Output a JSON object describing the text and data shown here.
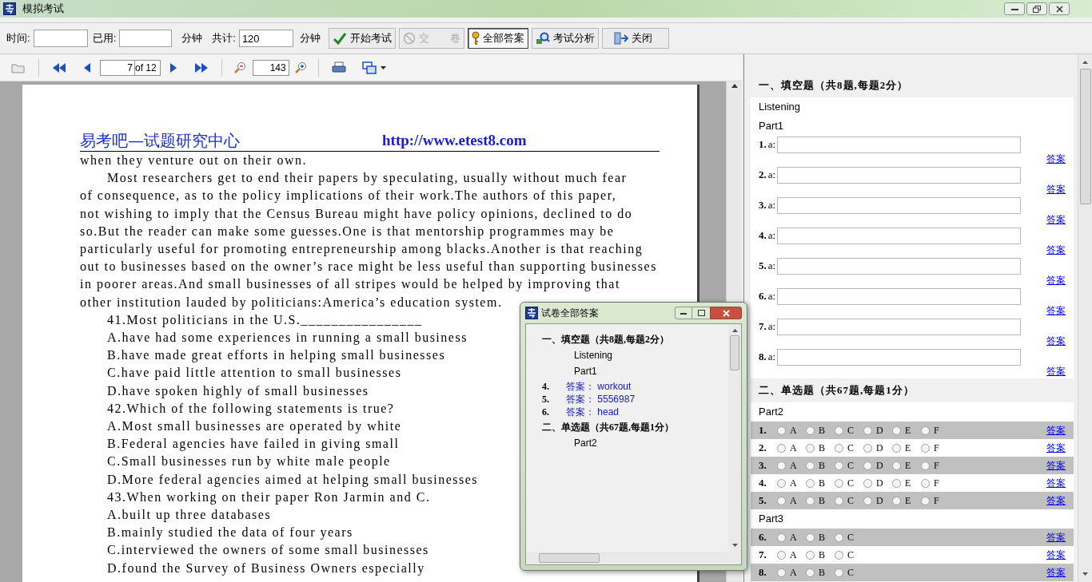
{
  "window": {
    "title": "模拟考试"
  },
  "exam_toolbar": {
    "fields": [
      {
        "label": "时间:"
      },
      {
        "label": "已用:",
        "unit": "分钟"
      },
      {
        "label": "共计:",
        "value": "120",
        "unit": "分钟"
      }
    ],
    "buttons": [
      {
        "kind": "check",
        "label": "开始考试",
        "disabled": false,
        "pressed": false
      },
      {
        "kind": "ban",
        "label": "交　　卷",
        "disabled": true,
        "pressed": false
      },
      {
        "kind": "key",
        "label": "全部答案",
        "disabled": false,
        "pressed": true
      },
      {
        "kind": "analyze",
        "label": "考试分析",
        "disabled": false,
        "pressed": false
      },
      {
        "kind": "exit",
        "label": "关闭",
        "disabled": false,
        "pressed": false
      }
    ]
  },
  "viewer_toolbar": {
    "page": "7",
    "page_total": "of 12",
    "zoom": "143"
  },
  "document": {
    "header_left": "易考吧—试题研究中心",
    "header_right": "http://www.etest8.com",
    "lines": [
      {
        "kind": "plain",
        "text": "when they venture out on their own."
      },
      {
        "kind": "indented",
        "text": "Most researchers get to end their papers by speculating, usually without much fear"
      },
      {
        "kind": "plain",
        "text": "of consequence, as to the policy implications of their work.The authors of this paper,"
      },
      {
        "kind": "plain",
        "text": "not wishing to imply that the Census Bureau might have policy opinions, declined to do"
      },
      {
        "kind": "plain",
        "text": "so.But the reader can make some guesses.One is that mentorship programmes may be"
      },
      {
        "kind": "plain",
        "text": "particularly useful for promoting entrepreneurship among blacks.Another is that reaching"
      },
      {
        "kind": "plain",
        "text": "out to businesses based on the owner’s race might be less useful than supporting businesses"
      },
      {
        "kind": "plain",
        "text": "in poorer areas.And small businesses of all stripes would be helped by improving that"
      },
      {
        "kind": "plain",
        "text": "other institution lauded by politicians:America’s education system."
      },
      {
        "kind": "indented",
        "text": "41.Most politicians in the U.S.________________"
      },
      {
        "kind": "indented",
        "text": "A.have had some experiences in running a small business"
      },
      {
        "kind": "indented",
        "text": "B.have made great efforts in helping small businesses"
      },
      {
        "kind": "indented",
        "text": "C.have paid little attention to small businesses"
      },
      {
        "kind": "indented",
        "text": "D.have spoken highly of small businesses"
      },
      {
        "kind": "indented",
        "text": "42.Which of the following statements is true?"
      },
      {
        "kind": "indented",
        "text": "A.Most small businesses are operated by white"
      },
      {
        "kind": "indented",
        "text": "B.Federal agencies have failed in giving small"
      },
      {
        "kind": "indented",
        "text": "C.Small businesses run by white male people"
      },
      {
        "kind": "indented",
        "text": "D.More federal agencies aimed at helping small businesses"
      },
      {
        "kind": "indented",
        "text": "43.When working on their paper Ron Jarmin and C."
      },
      {
        "kind": "indented",
        "text": "A.built up three databases"
      },
      {
        "kind": "indented",
        "text": "B.mainly studied the data of four years"
      },
      {
        "kind": "indented",
        "text": "C.interviewed the owners of some small businesses"
      },
      {
        "kind": "indented",
        "text": "D.found the Survey of Business Owners especially"
      }
    ]
  },
  "answer_sheet": {
    "sections": [
      {
        "kind": "fill",
        "title": "一、填空题（共8题,每题2分）",
        "parts": [
          {
            "label": "Listening"
          },
          {
            "label": "Part1",
            "questions": [
              {
                "number": "1.",
                "prefix": "a:",
                "link": "答案"
              },
              {
                "number": "2.",
                "prefix": "a:",
                "link": "答案"
              },
              {
                "number": "3.",
                "prefix": "a:",
                "link": "答案"
              },
              {
                "number": "4.",
                "prefix": "a:",
                "link": "答案"
              },
              {
                "number": "5.",
                "prefix": "a:",
                "link": "答案"
              },
              {
                "number": "6.",
                "prefix": "a:",
                "link": "答案"
              },
              {
                "number": "7.",
                "prefix": "a:",
                "link": "答案"
              },
              {
                "number": "8.",
                "prefix": "a:",
                "link": "答案"
              }
            ]
          }
        ]
      },
      {
        "kind": "choice",
        "title": "二、单选题（共67题,每题1分）",
        "parts": [
          {
            "label": "Part2",
            "questions": [
              {
                "number": "1.",
                "options": [
                  {
                    "label": "A",
                    "selected": false
                  },
                  {
                    "label": "B",
                    "selected": false
                  },
                  {
                    "label": "C",
                    "selected": false
                  },
                  {
                    "label": "D",
                    "selected": false
                  },
                  {
                    "label": "E",
                    "selected": false
                  },
                  {
                    "label": "F",
                    "selected": false
                  }
                ],
                "link": "答案"
              },
              {
                "number": "2.",
                "options": [
                  {
                    "label": "A",
                    "selected": false
                  },
                  {
                    "label": "B",
                    "selected": false
                  },
                  {
                    "label": "C",
                    "selected": false
                  },
                  {
                    "label": "D",
                    "selected": false
                  },
                  {
                    "label": "E",
                    "selected": false
                  },
                  {
                    "label": "F",
                    "selected": false
                  }
                ],
                "link": "答案"
              },
              {
                "number": "3.",
                "options": [
                  {
                    "label": "A",
                    "selected": false
                  },
                  {
                    "label": "B",
                    "selected": false
                  },
                  {
                    "label": "C",
                    "selected": false
                  },
                  {
                    "label": "D",
                    "selected": false
                  },
                  {
                    "label": "E",
                    "selected": false
                  },
                  {
                    "label": "F",
                    "selected": false
                  }
                ],
                "link": "答案"
              },
              {
                "number": "4.",
                "options": [
                  {
                    "label": "A",
                    "selected": false
                  },
                  {
                    "label": "B",
                    "selected": false
                  },
                  {
                    "label": "C",
                    "selected": false
                  },
                  {
                    "label": "D",
                    "selected": false
                  },
                  {
                    "label": "E",
                    "selected": false
                  },
                  {
                    "label": "F",
                    "selected": false
                  }
                ],
                "link": "答案"
              },
              {
                "number": "5.",
                "options": [
                  {
                    "label": "A",
                    "selected": false
                  },
                  {
                    "label": "B",
                    "selected": false
                  },
                  {
                    "label": "C",
                    "selected": false
                  },
                  {
                    "label": "D",
                    "selected": false
                  },
                  {
                    "label": "E",
                    "selected": false
                  },
                  {
                    "label": "F",
                    "selected": false
                  }
                ],
                "link": "答案"
              }
            ]
          },
          {
            "label": "Part3",
            "questions": [
              {
                "number": "6.",
                "options": [
                  {
                    "label": "A",
                    "selected": false
                  },
                  {
                    "label": "B",
                    "selected": false
                  },
                  {
                    "label": "C",
                    "selected": false
                  }
                ],
                "link": "答案"
              },
              {
                "number": "7.",
                "options": [
                  {
                    "label": "A",
                    "selected": false
                  },
                  {
                    "label": "B",
                    "selected": false
                  },
                  {
                    "label": "C",
                    "selected": false
                  }
                ],
                "link": "答案"
              },
              {
                "number": "8.",
                "options": [
                  {
                    "label": "A",
                    "selected": false
                  },
                  {
                    "label": "B",
                    "selected": false
                  },
                  {
                    "label": "C",
                    "selected": false
                  }
                ],
                "link": "答案"
              }
            ]
          }
        ]
      }
    ]
  },
  "answers_dialog": {
    "title": "试卷全部答案",
    "items": [
      {
        "kind": "heading",
        "text": "一、填空题（共8题,每题2分）"
      },
      {
        "kind": "part",
        "text": "Listening"
      },
      {
        "kind": "part",
        "text": "Part1"
      },
      {
        "kind": "answer",
        "number": "4.",
        "label": "答案：",
        "value": "workout"
      },
      {
        "kind": "answer",
        "number": "5.",
        "label": "答案：",
        "value": "5556987"
      },
      {
        "kind": "answer",
        "number": "6.",
        "label": "答案：",
        "value": "head"
      },
      {
        "kind": "heading",
        "text": "二、单选题（共67题,每题1分）"
      },
      {
        "kind": "part",
        "text": "Part2"
      }
    ]
  }
}
